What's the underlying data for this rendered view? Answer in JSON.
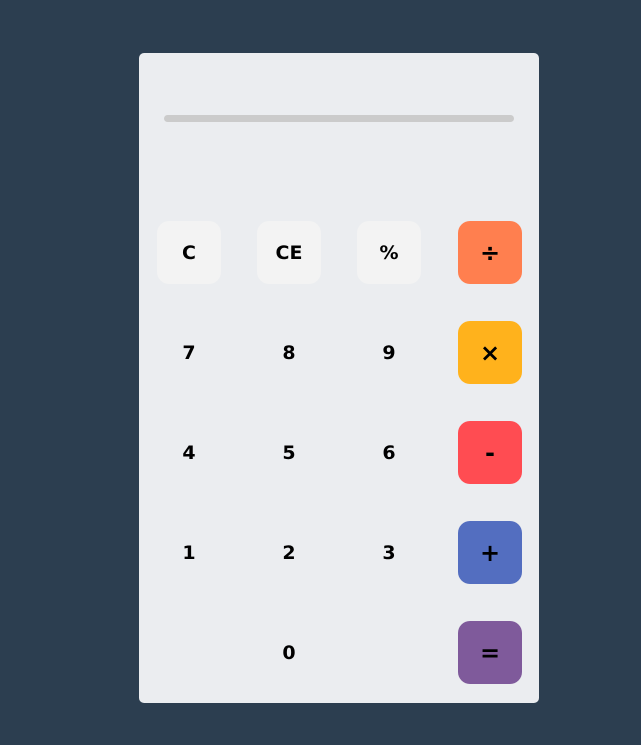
{
  "display": {
    "value": ""
  },
  "keys": {
    "clear": "C",
    "clear_entry": "CE",
    "percent": "%",
    "divide": "÷",
    "seven": "7",
    "eight": "8",
    "nine": "9",
    "multiply": "×",
    "four": "4",
    "five": "5",
    "six": "6",
    "subtract": "-",
    "one": "1",
    "two": "2",
    "three": "3",
    "add": "+",
    "zero": "0",
    "equals": "="
  },
  "colors": {
    "background": "#2c3e50",
    "panel": "#ebedf0",
    "display_bar": "#cbcbcb",
    "function_key": "#f3f3f3",
    "divide": "#ff7f4f",
    "multiply": "#ffb21c",
    "subtract": "#ff4c52",
    "add": "#536ec0",
    "equals": "#7f5a9b"
  }
}
